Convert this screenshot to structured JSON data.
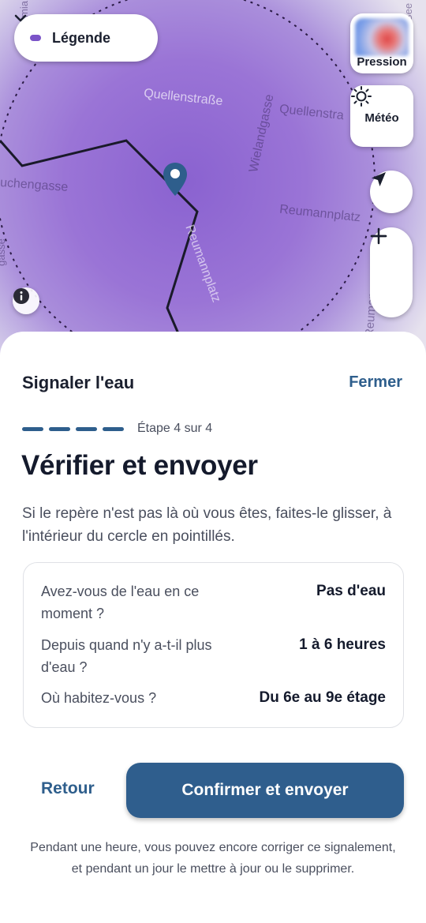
{
  "map": {
    "streets": [
      "Quellenstraße",
      "Quellenstra",
      "Wielandgasse",
      "uchengasse",
      "Reumannplatz",
      "Reumannplatz",
      "gasse",
      "mia",
      "Reumann",
      "See"
    ],
    "legend_label": "Légende",
    "pression_label": "Pression",
    "meteo_label": "Météo"
  },
  "colors": {
    "accent": "#2e5e8c",
    "area": "#8a62d0"
  },
  "sheet": {
    "title": "Signaler l'eau",
    "close_label": "Fermer",
    "step_label": "Étape 4 sur 4",
    "heading": "Vérifier et envoyer",
    "description": "Si le repère n'est pas là où vous êtes, faites-le glisser, à l'intérieur du cercle en pointillés.",
    "summary": [
      {
        "question": "Avez-vous de l'eau en ce moment ?",
        "answer": "Pas d'eau"
      },
      {
        "question": "Depuis quand n'y a-t-il plus d'eau ?",
        "answer": "1 à 6 heures"
      },
      {
        "question": "Où habitez-vous ?",
        "answer": "Du 6e au 9e étage"
      }
    ],
    "back_label": "Retour",
    "confirm_label": "Confirmer et envoyer",
    "footnote": "Pendant une heure, vous pouvez encore corriger ce signalement, et pendant un jour le mettre à jour ou le supprimer."
  }
}
